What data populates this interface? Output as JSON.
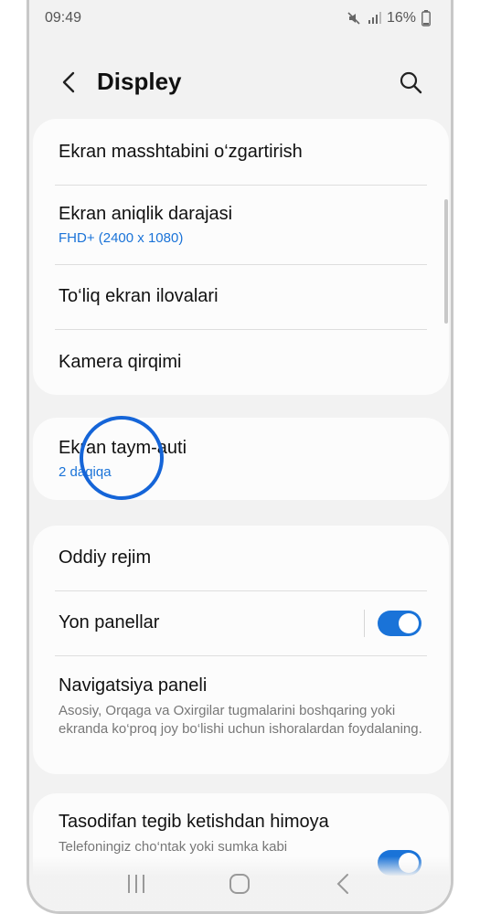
{
  "status_bar": {
    "time": "09:49",
    "battery": "16%",
    "icons": [
      "mute-icon",
      "signal-icon",
      "battery-icon"
    ]
  },
  "header": {
    "title": "Displey",
    "back_icon": "back-arrow-icon",
    "search_icon": "search-icon"
  },
  "groups": [
    {
      "items": [
        {
          "title": "Ekran masshtabini o‘zgartirish"
        },
        {
          "title": "Ekran aniqlik darajasi",
          "subtitle": "FHD+ (2400 x 1080)"
        },
        {
          "title": "To‘liq ekran ilovalari"
        },
        {
          "title": "Kamera qirqimi"
        }
      ]
    },
    {
      "items": [
        {
          "title": "Ekran taym-auti",
          "subtitle": "2 daqiqa"
        }
      ]
    },
    {
      "items": [
        {
          "title": "Oddiy rejim"
        },
        {
          "title": "Yon panellar",
          "toggle": "on"
        },
        {
          "title": "Navigatsiya paneli",
          "description": "Asosiy, Orqaga va Oxirgilar tugmalarini boshqaring yoki ekranda ko‘proq joy bo‘lishi uchun ishoralardan foydalaning."
        }
      ]
    },
    {
      "items": [
        {
          "title": "Tasodifan tegib ketishdan himoya",
          "description": "Telefoningiz cho‘ntak yoki sumka kabi",
          "toggle": "on"
        }
      ]
    }
  ],
  "colors": {
    "accent": "#1a73d8",
    "background": "#f2f2f2",
    "card": "#fcfcfc"
  },
  "nav_bar": {
    "icons": [
      "recents-icon",
      "home-icon",
      "back-icon"
    ]
  }
}
